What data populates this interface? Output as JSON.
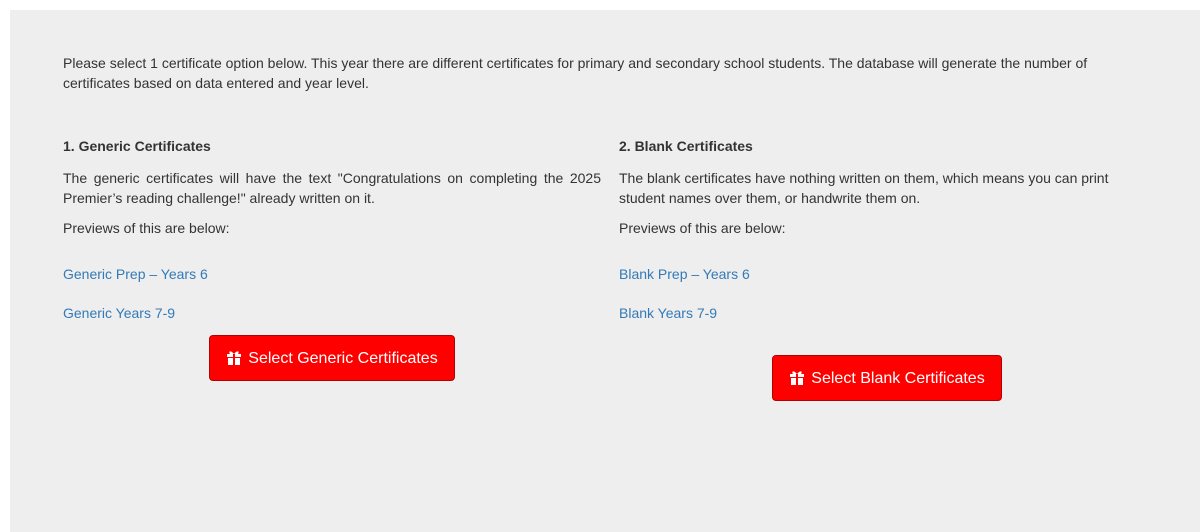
{
  "intro": "Please select 1 certificate option below. This year there are different certificates for primary and secondary school students. The database will generate the number of certificates based on data entered and year level.",
  "generic": {
    "heading": "1. Generic Certificates",
    "description": "The generic certificates will have the text \"Congratulations on completing the 2025 Premier’s reading challenge!\" already written on it.",
    "previews_label": "Previews of this are below:",
    "links": [
      "Generic Prep – Years 6",
      "Generic Years 7-9"
    ],
    "button_label": "Select Generic Certificates",
    "button_icon": "gift-icon"
  },
  "blank": {
    "heading": "2. Blank Certificates",
    "description": "The blank certificates have nothing written on them, which means you can print student names over them, or handwrite them on.",
    "previews_label": "Previews of this are below:",
    "links": [
      "Blank Prep – Years 6",
      "Blank Years 7-9"
    ],
    "button_label": "Select Blank Certificates",
    "button_icon": "gift-icon"
  },
  "colors": {
    "button_bg": "#ff0000",
    "link": "#337ab7",
    "panel_bg": "#eeeeee",
    "text": "#333333"
  }
}
